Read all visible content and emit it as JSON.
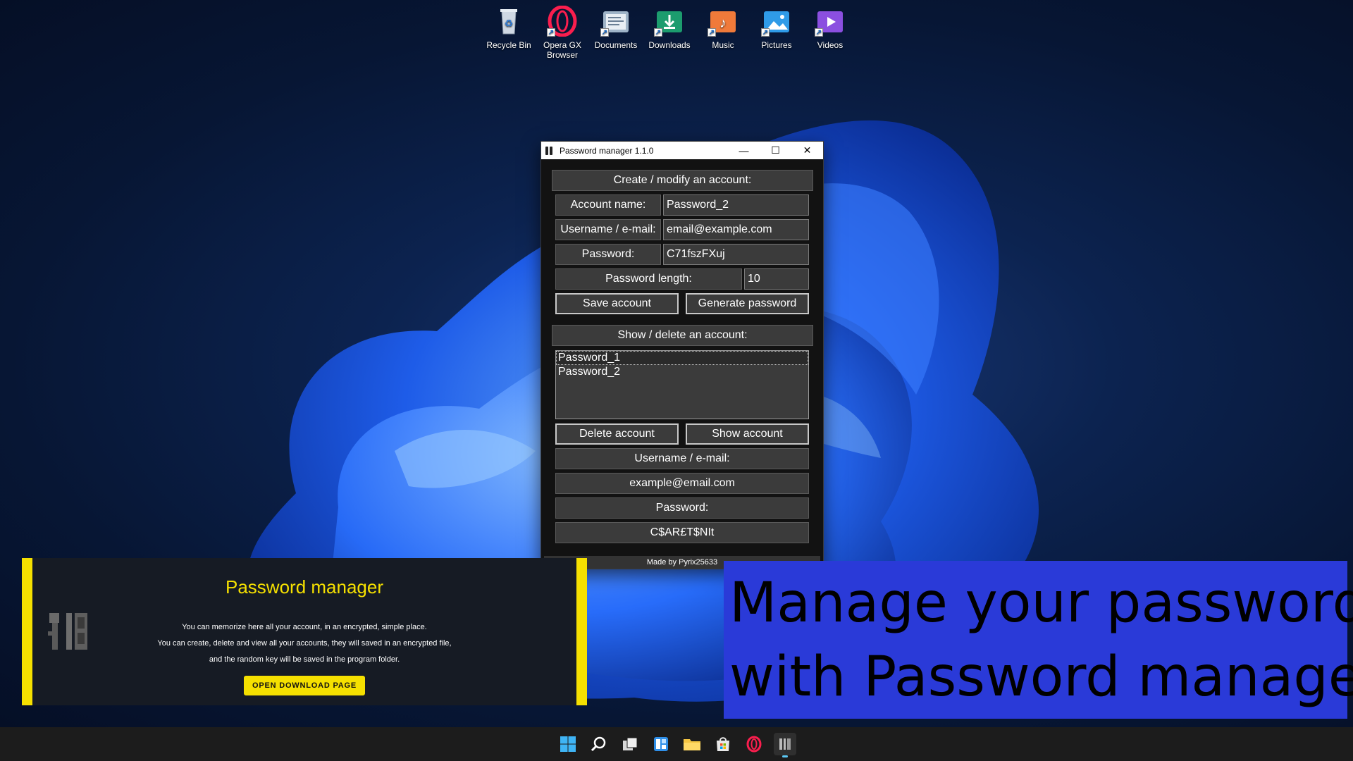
{
  "desktop": {
    "icons": [
      {
        "label": "Recycle Bin",
        "icon": "recycle-bin-icon"
      },
      {
        "label": "Opera GX Browser",
        "icon": "opera-gx-icon"
      },
      {
        "label": "Documents",
        "icon": "documents-folder-icon"
      },
      {
        "label": "Downloads",
        "icon": "downloads-folder-icon"
      },
      {
        "label": "Music",
        "icon": "music-folder-icon"
      },
      {
        "label": "Pictures",
        "icon": "pictures-folder-icon"
      },
      {
        "label": "Videos",
        "icon": "videos-folder-icon"
      }
    ]
  },
  "window": {
    "title": "Password manager 1.1.0",
    "create_header": "Create / modify an account:",
    "account_name_label": "Account name:",
    "account_name_value": "Password_2",
    "username_label": "Username / e-mail:",
    "username_value": "email@example.com",
    "password_label": "Password:",
    "password_value": "C71fszFXuj",
    "length_label": "Password length:",
    "length_value": "10",
    "save_button": "Save account",
    "generate_button": "Generate password",
    "show_header": "Show / delete an account:",
    "accounts": [
      "Password_1",
      "Password_2"
    ],
    "delete_button": "Delete account",
    "show_button": "Show account",
    "shown_username_label": "Username / e-mail:",
    "shown_username_value": "example@email.com",
    "shown_password_label": "Password:",
    "shown_password_value": "C$AR£T$NIt",
    "footer": "Made by Pyrix25633"
  },
  "promo": {
    "title": "Password manager",
    "line1": "You can memorize here all your account, in an encrypted, simple place.",
    "line2": "You can create, delete and view all your accounts, they will saved in an encrypted file,",
    "line3": "and the random key will be saved in the program folder.",
    "button": "OPEN DOWNLOAD PAGE"
  },
  "caption": {
    "line1": "Manage your passwords",
    "line2": "with Password manager"
  },
  "taskbar": {
    "icons": [
      "windows-start-icon",
      "search-icon",
      "task-view-icon",
      "widgets-icon",
      "file-explorer-icon",
      "microsoft-store-icon",
      "opera-gx-icon",
      "password-manager-icon"
    ],
    "accent": "#5cc9f5"
  },
  "colors": {
    "promo_accent": "#f5e000",
    "caption_bg": "#2a3ad8",
    "window_bg": "#121212",
    "field_bg": "#3b3b3b"
  }
}
